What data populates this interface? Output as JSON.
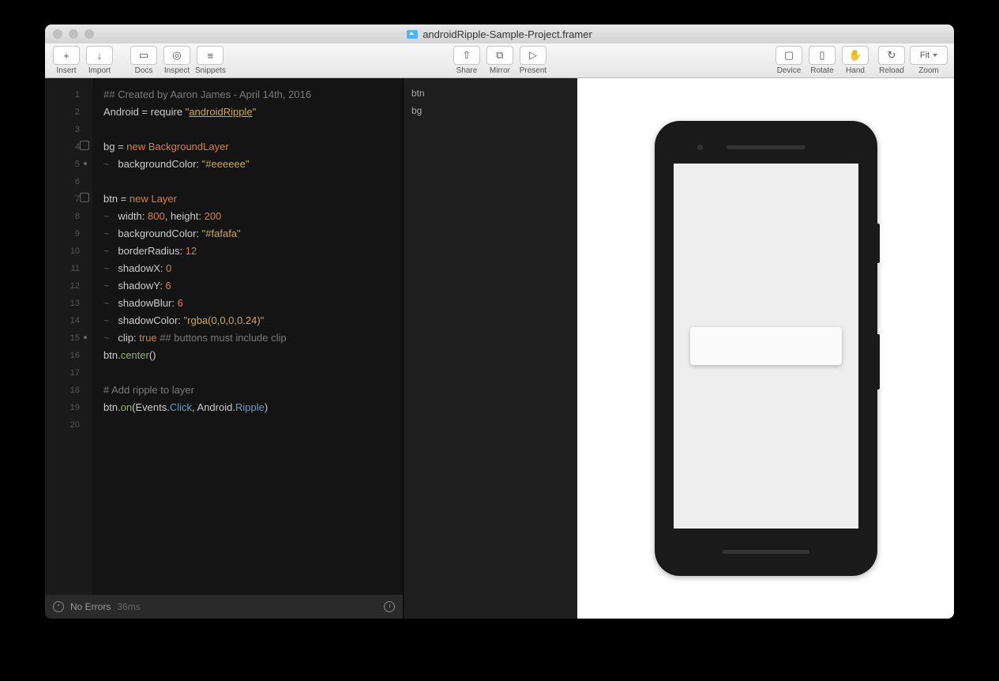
{
  "window": {
    "title": "androidRipple-Sample-Project.framer"
  },
  "toolbar": {
    "left": [
      {
        "label": "Insert",
        "glyph": "+"
      },
      {
        "label": "Import",
        "glyph": "↓"
      }
    ],
    "docs": [
      {
        "label": "Docs",
        "glyph": "▭"
      },
      {
        "label": "Inspect",
        "glyph": "◎"
      },
      {
        "label": "Snippets",
        "glyph": "≡"
      }
    ],
    "share": [
      {
        "label": "Share",
        "glyph": "⇧"
      },
      {
        "label": "Mirror",
        "glyph": "⧉"
      },
      {
        "label": "Present",
        "glyph": "▷"
      }
    ],
    "device": [
      {
        "label": "Device",
        "glyph": "▢"
      },
      {
        "label": "Rotate",
        "glyph": "▯"
      },
      {
        "label": "Hand",
        "glyph": "✋"
      }
    ],
    "right": [
      {
        "label": "Reload",
        "glyph": "↻"
      }
    ],
    "zoom": {
      "label": "Zoom",
      "value": "Fit"
    }
  },
  "code": {
    "lines": [
      {
        "n": "1",
        "html": "<span class='c-comment'>## Created by Aaron James - April 14th, 2016</span>"
      },
      {
        "n": "2",
        "html": "Android = require <span class='c-str'>\"</span><span class='c-underline'>androidRipple</span><span class='c-str'>\"</span>"
      },
      {
        "n": "3",
        "html": ""
      },
      {
        "n": "4",
        "html": "bg = <span class='c-kw'>new</span> <span class='c-glob'>BackgroundLayer</span>",
        "fold": true
      },
      {
        "n": "5",
        "html": "<span class='tilde'>~</span>   backgroundColor: <span class='c-str'>\"#eeeeee\"</span>",
        "dot": true
      },
      {
        "n": "6",
        "html": ""
      },
      {
        "n": "7",
        "html": "btn = <span class='c-kw'>new</span> <span class='c-glob'>Layer</span>",
        "fold": true
      },
      {
        "n": "8",
        "html": "<span class='tilde'>~</span>   width: <span class='c-num'>800</span>, height: <span class='c-num'>200</span>"
      },
      {
        "n": "9",
        "html": "<span class='tilde'>~</span>   backgroundColor: <span class='c-str'>\"#fafafa\"</span>"
      },
      {
        "n": "10",
        "html": "<span class='tilde'>~</span>   borderRadius: <span class='c-num'>12</span>"
      },
      {
        "n": "11",
        "html": "<span class='tilde'>~</span>   shadowX: <span class='c-num'>0</span>"
      },
      {
        "n": "12",
        "html": "<span class='tilde'>~</span>   shadowY: <span class='c-num'>6</span>"
      },
      {
        "n": "13",
        "html": "<span class='tilde'>~</span>   shadowBlur: <span class='c-num'>6</span>"
      },
      {
        "n": "14",
        "html": "<span class='tilde'>~</span>   shadowColor: <span class='c-str'>\"rgba(0,0,0,0.24)\"</span>"
      },
      {
        "n": "15",
        "html": "<span class='tilde'>~</span>   clip: <span class='c-kw'>true</span> <span class='c-comment'>## buttons must include clip</span>",
        "dot": true
      },
      {
        "n": "16",
        "html": "btn.<span class='c-fn'>center</span>()"
      },
      {
        "n": "17",
        "html": ""
      },
      {
        "n": "18",
        "html": "<span class='c-comment'># Add ripple to layer</span>"
      },
      {
        "n": "19",
        "html": "btn.<span class='c-fn'>on</span>(Events.<span class='c-prop'>Click</span>, Android.<span class='c-prop'>Ripple</span>)"
      },
      {
        "n": "20",
        "html": ""
      }
    ]
  },
  "status": {
    "errors": "No Errors",
    "time": "36ms"
  },
  "layers": {
    "items": [
      "btn",
      "bg"
    ]
  },
  "preview": {
    "bgColor": "#eeeeee",
    "cardColor": "#fafafa"
  }
}
